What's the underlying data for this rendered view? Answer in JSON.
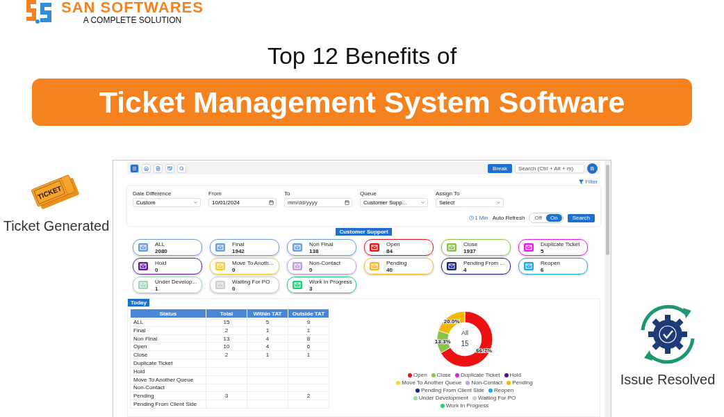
{
  "brand": {
    "name": "SAN SOFTWARES",
    "tagline": "A COMPLETE SOLUTION"
  },
  "headline": "Top 12 Benefits of",
  "banner": "Ticket Management System Software",
  "left_callout": {
    "ticket_text": "TICKET",
    "caption": "Ticket Generated"
  },
  "right_callout": {
    "caption": "Issue Resolved"
  },
  "app": {
    "toolbar": {
      "icons": [
        {
          "kind": "menu",
          "selected": true
        },
        {
          "kind": "home",
          "selected": false
        },
        {
          "kind": "document",
          "selected": false
        },
        {
          "kind": "handshake",
          "selected": false
        },
        {
          "kind": "search",
          "selected": false
        }
      ],
      "break_button": "Break",
      "search": {
        "placeholder": "Search (Ctrl + Alt + m)"
      },
      "avatar": "B"
    },
    "filter_link": "Filter",
    "filters": [
      {
        "kind": "select",
        "label": "Date Difference",
        "value": "Custom"
      },
      {
        "kind": "date",
        "label": "From",
        "value": "10/01/2024"
      },
      {
        "kind": "date",
        "label": "To",
        "placeholder": "mm/dd/yyyy"
      },
      {
        "kind": "select",
        "label": "Queue",
        "value": "Customer Supp..."
      },
      {
        "kind": "select",
        "label": "Assign To",
        "value": "Select"
      }
    ],
    "refresh_interval": "1 Min",
    "auto_refresh": {
      "label": "Auto Refresh",
      "options": [
        {
          "label": "Off",
          "selected": false
        },
        {
          "label": "On",
          "selected": true
        }
      ]
    },
    "search_button": "Search",
    "queue_badge": "Customer Support",
    "cards": [
      {
        "label": "ALL",
        "count": "2080",
        "color": "#6a9fd8"
      },
      {
        "label": "Final",
        "count": "1942",
        "color": "#6a9fd8"
      },
      {
        "label": "Non Final",
        "count": "138",
        "color": "#6a9fd8"
      },
      {
        "label": "Open",
        "count": "84",
        "color": "#e8141b"
      },
      {
        "label": "Close",
        "count": "1937",
        "color": "#8bc34a"
      },
      {
        "label": "Duplicate Ticket",
        "count": "5",
        "color": "#e619e6"
      },
      {
        "label": "Hold",
        "count": "0",
        "color": "#6a1b9a"
      },
      {
        "label": "Move To Anoth...",
        "count": "0",
        "color": "#f2cf3a"
      },
      {
        "label": "Non-Contact",
        "count": "0",
        "color": "#c29fdc"
      },
      {
        "label": "Pending",
        "count": "40",
        "color": "#f5b82a"
      },
      {
        "label": "Pending From ...",
        "count": "4",
        "color": "#1a237e"
      },
      {
        "label": "Reopen",
        "count": "6",
        "color": "#1ea7e0"
      },
      {
        "label": "Under Develop...",
        "count": "1",
        "color": "#9fd6b8"
      },
      {
        "label": "Waiting For PO",
        "count": "0",
        "color": "#cccccc"
      },
      {
        "label": "Work In Progress",
        "count": "3",
        "color": "#1ecf7a"
      }
    ],
    "today": {
      "title": "Today",
      "table": {
        "columns": [
          "Status",
          "Total",
          "Within TAT",
          "Outside TAT"
        ],
        "rows": [
          {
            "status": "ALL",
            "total": "15",
            "within": "5",
            "outside": "9"
          },
          {
            "status": "Final",
            "total": "2",
            "within": "1",
            "outside": "1"
          },
          {
            "status": "Non Final",
            "total": "13",
            "within": "4",
            "outside": "8"
          },
          {
            "status": "Open",
            "total": "10",
            "within": "4",
            "outside": "6"
          },
          {
            "status": "Close",
            "total": "2",
            "within": "1",
            "outside": "1"
          },
          {
            "status": "Duplicate Ticket"
          },
          {
            "status": "Hold"
          },
          {
            "status": "Move To Another Queue"
          },
          {
            "status": "Non-Contact"
          },
          {
            "status": "Pending",
            "total": "3",
            "outside": "2"
          },
          {
            "status": "Pending From Client Side"
          }
        ]
      },
      "chart": {
        "center_title": "All",
        "center_value": "15",
        "chart_data": {
          "type": "donut",
          "categories": [
            "Open",
            "Close",
            "Duplicate Ticket",
            "Hold",
            "Move To Another Queue",
            "Non-Contact",
            "Pending",
            "Pending From Client Side",
            "Reopen",
            "Under Development",
            "Waiting For PO",
            "Work In Progress"
          ],
          "values": [
            66.7,
            13.3,
            null,
            null,
            null,
            null,
            20.0,
            null,
            null,
            null,
            null,
            null
          ],
          "colors": [
            "#ee1111",
            "#8bc34a",
            "#e619e6",
            "#4a148c",
            "#f5d33a",
            "#c8a2dc",
            "#f5b700",
            "#1a237e",
            "#1ea7e0",
            "#9fd6b8",
            "#cccccc",
            "#1ecf7a"
          ],
          "value_labels": [
            "66.7%",
            "13.3%",
            null,
            null,
            null,
            null,
            "20.0%",
            null,
            null,
            null,
            null,
            null
          ],
          "legend": "bottom"
        }
      }
    }
  }
}
